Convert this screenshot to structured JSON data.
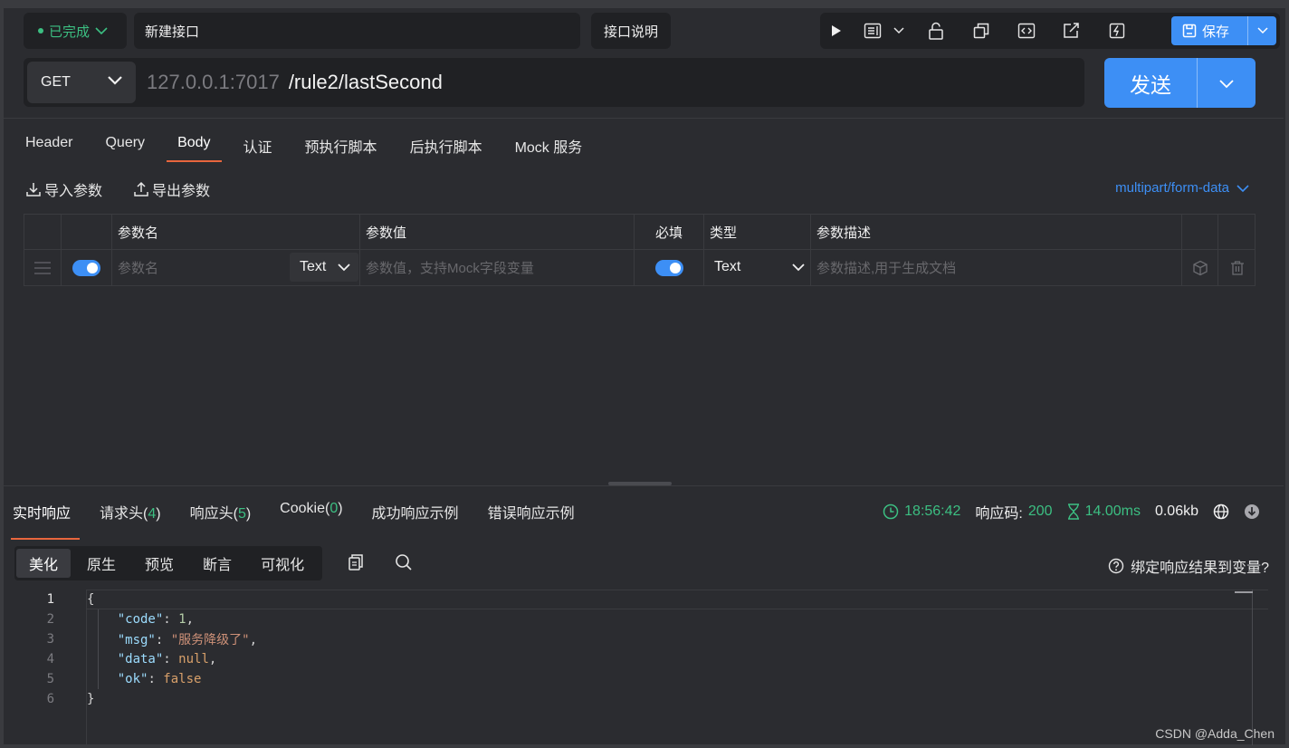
{
  "topbar": {
    "status": "已完成",
    "api_name": "新建接口",
    "doc_label": "接口说明",
    "save_label": "保存"
  },
  "url": {
    "method": "GET",
    "host": "127.0.0.1:7017",
    "path": "/rule2/lastSecond",
    "send_label": "发送"
  },
  "request_tabs": [
    "Header",
    "Query",
    "Body",
    "认证",
    "预执行脚本",
    "后执行脚本",
    "Mock 服务"
  ],
  "active_request_tab": "Body",
  "body": {
    "import_label": "导入参数",
    "export_label": "导出参数",
    "content_type": "multipart/form-data",
    "columns": [
      "参数名",
      "参数值",
      "必填",
      "类型",
      "参数描述"
    ],
    "row": {
      "name_placeholder": "参数名",
      "field_type": "Text",
      "value_placeholder": "参数值，支持Mock字段变量",
      "required": true,
      "type": "Text",
      "desc_placeholder": "参数描述,用于生成文档"
    }
  },
  "response": {
    "tabs": [
      {
        "label": "实时响应",
        "count": ""
      },
      {
        "label": "请求头(",
        "count": "4",
        "suffix": ")"
      },
      {
        "label": "响应头(",
        "count": "5",
        "suffix": ")"
      },
      {
        "label": "Cookie(",
        "count": "0",
        "suffix": ")"
      },
      {
        "label": "成功响应示例",
        "count": ""
      },
      {
        "label": "错误响应示例",
        "count": ""
      }
    ],
    "time": "18:56:42",
    "status_label": "响应码:",
    "status_code": "200",
    "duration": "14.00ms",
    "size": "0.06kb",
    "view_tabs": [
      "美化",
      "原生",
      "预览",
      "断言",
      "可视化"
    ],
    "bind_label": "绑定响应结果到变量?",
    "code_lines": [
      "1",
      "2",
      "3",
      "4",
      "5",
      "6"
    ],
    "json": {
      "code_key": "\"code\"",
      "code_val": "1",
      "msg_key": "\"msg\"",
      "msg_val": "\"服务降级了\"",
      "data_key": "\"data\"",
      "data_val": "null",
      "ok_key": "\"ok\"",
      "ok_val": "false"
    }
  },
  "watermark": "CSDN @Adda_Chen",
  "colors": {
    "accent": "#3d8ff5",
    "success": "#3cbf82",
    "tab_underline": "#e8663d"
  }
}
